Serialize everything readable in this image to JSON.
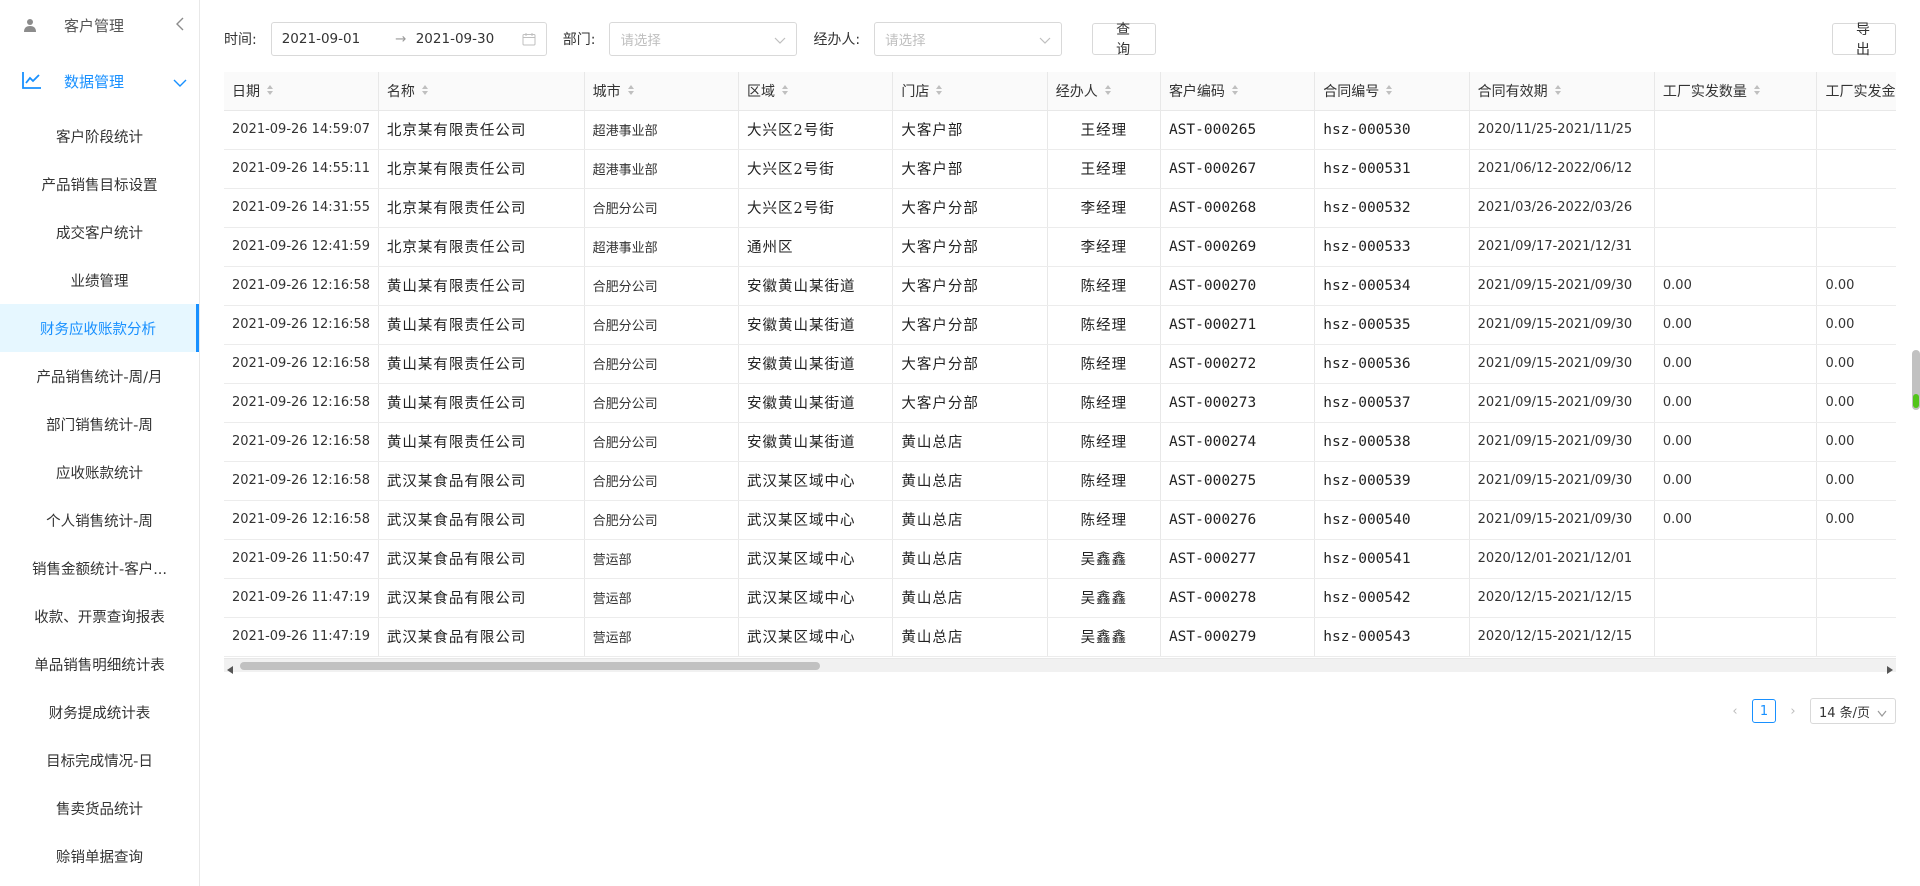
{
  "sidebar": {
    "top_item": "客户管理",
    "group": "数据管理",
    "items": [
      {
        "label": "客户阶段统计",
        "active": false
      },
      {
        "label": "产品销售目标设置",
        "active": false
      },
      {
        "label": "成交客户统计",
        "active": false
      },
      {
        "label": "业绩管理",
        "active": false
      },
      {
        "label": "财务应收账款分析",
        "active": true
      },
      {
        "label": "产品销售统计-周/月",
        "active": false
      },
      {
        "label": "部门销售统计-周",
        "active": false
      },
      {
        "label": "应收账款统计",
        "active": false
      },
      {
        "label": "个人销售统计-周",
        "active": false
      },
      {
        "label": "销售金额统计-客户...",
        "active": false
      },
      {
        "label": "收款、开票查询报表",
        "active": false
      },
      {
        "label": "单品销售明细统计表",
        "active": false
      },
      {
        "label": "财务提成统计表",
        "active": false
      },
      {
        "label": "目标完成情况-日",
        "active": false
      },
      {
        "label": "售卖货品统计",
        "active": false
      },
      {
        "label": "赊销单据查询",
        "active": false
      }
    ]
  },
  "filters": {
    "time_label": "时间:",
    "start_date": "2021-09-01",
    "end_date": "2021-09-30",
    "dept_label": "部门:",
    "dept_placeholder": "请选择",
    "agent_label": "经办人:",
    "agent_placeholder": "请选择",
    "query_button": "查 询",
    "export_button": "导 出"
  },
  "table": {
    "columns": [
      "日期",
      "名称",
      "城市",
      "区域",
      "门店",
      "经办人",
      "客户编码",
      "合同编号",
      "合同有效期",
      "工厂实发数量",
      "工厂实发金额"
    ],
    "rows": [
      [
        "2021-09-26 14:59:07",
        "北京某有限责任公司",
        "超港事业部",
        "大兴区2号街",
        "大客户部",
        "王经理",
        "AST-000265",
        "hsz-000530",
        "2020/11/25-2021/11/25",
        "",
        ""
      ],
      [
        "2021-09-26 14:55:11",
        "北京某有限责任公司",
        "超港事业部",
        "大兴区2号街",
        "大客户部",
        "王经理",
        "AST-000267",
        "hsz-000531",
        "2021/06/12-2022/06/12",
        "",
        ""
      ],
      [
        "2021-09-26 14:31:55",
        "北京某有限责任公司",
        "合肥分公司",
        "大兴区2号街",
        "大客户分部",
        "李经理",
        "AST-000268",
        "hsz-000532",
        "2021/03/26-2022/03/26",
        "",
        ""
      ],
      [
        "2021-09-26 12:41:59",
        "北京某有限责任公司",
        "超港事业部",
        "通州区",
        "大客户分部",
        "李经理",
        "AST-000269",
        "hsz-000533",
        "2021/09/17-2021/12/31",
        "",
        ""
      ],
      [
        "2021-09-26 12:16:58",
        "黄山某有限责任公司",
        "合肥分公司",
        "安徽黄山某街道",
        "大客户分部",
        "陈经理",
        "AST-000270",
        "hsz-000534",
        "2021/09/15-2021/09/30",
        "0.00",
        "0.00"
      ],
      [
        "2021-09-26 12:16:58",
        "黄山某有限责任公司",
        "合肥分公司",
        "安徽黄山某街道",
        "大客户分部",
        "陈经理",
        "AST-000271",
        "hsz-000535",
        "2021/09/15-2021/09/30",
        "0.00",
        "0.00"
      ],
      [
        "2021-09-26 12:16:58",
        "黄山某有限责任公司",
        "合肥分公司",
        "安徽黄山某街道",
        "大客户分部",
        "陈经理",
        "AST-000272",
        "hsz-000536",
        "2021/09/15-2021/09/30",
        "0.00",
        "0.00"
      ],
      [
        "2021-09-26 12:16:58",
        "黄山某有限责任公司",
        "合肥分公司",
        "安徽黄山某街道",
        "大客户分部",
        "陈经理",
        "AST-000273",
        "hsz-000537",
        "2021/09/15-2021/09/30",
        "0.00",
        "0.00"
      ],
      [
        "2021-09-26 12:16:58",
        "黄山某有限责任公司",
        "合肥分公司",
        "安徽黄山某街道",
        "黄山总店",
        "陈经理",
        "AST-000274",
        "hsz-000538",
        "2021/09/15-2021/09/30",
        "0.00",
        "0.00"
      ],
      [
        "2021-09-26 12:16:58",
        "武汉某食品有限公司",
        "合肥分公司",
        "武汉某区域中心",
        "黄山总店",
        "陈经理",
        "AST-000275",
        "hsz-000539",
        "2021/09/15-2021/09/30",
        "0.00",
        "0.00"
      ],
      [
        "2021-09-26 12:16:58",
        "武汉某食品有限公司",
        "合肥分公司",
        "武汉某区域中心",
        "黄山总店",
        "陈经理",
        "AST-000276",
        "hsz-000540",
        "2021/09/15-2021/09/30",
        "0.00",
        "0.00"
      ],
      [
        "2021-09-26 11:50:47",
        "武汉某食品有限公司",
        "营运部",
        "武汉某区域中心",
        "黄山总店",
        "吴鑫鑫",
        "AST-000277",
        "hsz-000541",
        "2020/12/01-2021/12/01",
        "",
        ""
      ],
      [
        "2021-09-26 11:47:19",
        "武汉某食品有限公司",
        "营运部",
        "武汉某区域中心",
        "黄山总店",
        "吴鑫鑫",
        "AST-000278",
        "hsz-000542",
        "2020/12/15-2021/12/15",
        "",
        ""
      ],
      [
        "2021-09-26 11:47:19",
        "武汉某食品有限公司",
        "营运部",
        "武汉某区域中心",
        "黄山总店",
        "吴鑫鑫",
        "AST-000279",
        "hsz-000543",
        "2020/12/15-2021/12/15",
        "",
        ""
      ]
    ]
  },
  "pagination": {
    "current_page": "1",
    "page_size": "14 条/页"
  },
  "colors": {
    "accent": "#1890ff",
    "active_bg": "#e6f7ff"
  }
}
